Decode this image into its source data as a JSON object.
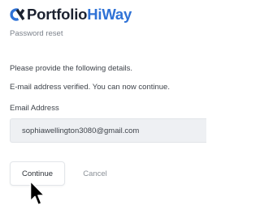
{
  "brand": {
    "name_part1": "Portfolio",
    "name_part2": "HiWay",
    "logo_icon": "portfoliohiway-logo-mark",
    "colors": {
      "dark": "#1c2230",
      "accent": "#2f72d6"
    }
  },
  "page": {
    "subtitle": "Password reset",
    "instructions": "Please provide the following details.",
    "status_message": "E-mail address verified. You can now continue."
  },
  "form": {
    "email_label": "Email Address",
    "email_value": "sophiawellington3080@gmail.com"
  },
  "actions": {
    "continue_label": "Continue",
    "cancel_label": "Cancel"
  },
  "cursor": {
    "icon": "mouse-pointer-icon"
  }
}
